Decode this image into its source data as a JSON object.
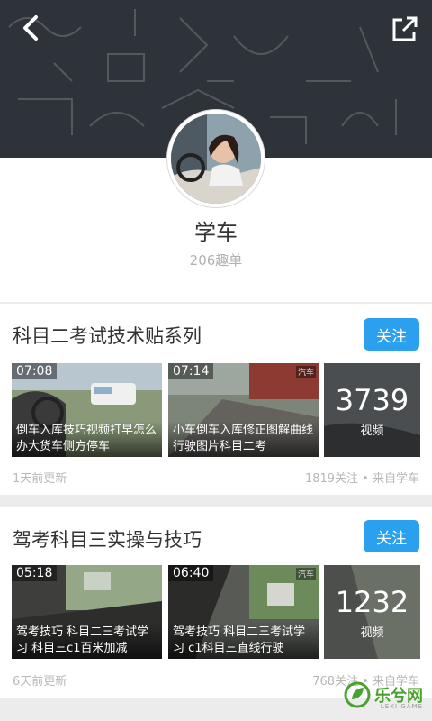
{
  "profile": {
    "title": "学车",
    "subtitle": "206趣单"
  },
  "cards": [
    {
      "title": "科目二考试技术贴系列",
      "follow_label": "关注",
      "videos": [
        {
          "duration": "07:08",
          "caption": "倒车入库技巧视频打早怎么办大货车侧方停车"
        },
        {
          "duration": "07:14",
          "caption": "小车倒车入库修正图解曲线行驶图片科目二考"
        }
      ],
      "count": "3739",
      "count_label": "视频",
      "updated": "1天前更新",
      "followers": "1819关注 • 来自学车"
    },
    {
      "title": "驾考科目三实操与技巧",
      "follow_label": "关注",
      "videos": [
        {
          "duration": "05:18",
          "caption": "驾考技巧 科目二三考试学习 科目三c1百米加减"
        },
        {
          "duration": "06:40",
          "caption": "驾考技巧 科目二三考试学习 c1科目三直线行驶"
        }
      ],
      "count": "1232",
      "count_label": "视频",
      "updated": "6天前更新",
      "followers": "768关注 • 来自学车"
    }
  ],
  "watermark": {
    "text": "乐兮网",
    "sub": "LEXI GAME"
  },
  "colors": {
    "accent": "#2aa0ef",
    "hero_bg": "#2e3339",
    "watermark": "#4aa22e"
  }
}
